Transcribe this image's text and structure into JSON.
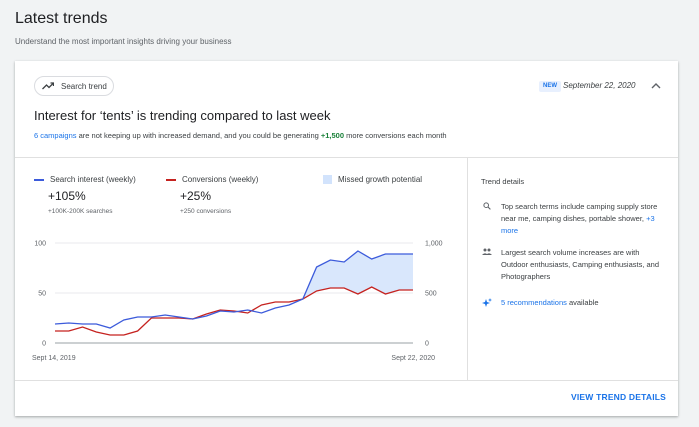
{
  "page": {
    "title": "Latest trends",
    "subtitle": "Understand the most important insights driving your business"
  },
  "card": {
    "chip_label": "Search trend",
    "new_badge": "NEW",
    "date": "September 22, 2020",
    "headline": "Interest for ‘tents’ is trending compared to last week",
    "desc": {
      "campaigns_link": "6 campaigns",
      "text1": " are not keeping up with increased demand, and you could be generating ",
      "conversions": "+1,500",
      "text2": " more conversions each month"
    }
  },
  "metrics": {
    "search": {
      "legend": "Search interest (weekly)",
      "value": "+105%",
      "sub": "+100K-200K searches",
      "color": "#3c5bdb"
    },
    "conversions": {
      "legend": "Conversions (weekly)",
      "value": "+25%",
      "sub": "+250 conversions",
      "color": "#c5221f"
    },
    "missed": {
      "legend": "Missed growth potential",
      "color": "#d2e3fc"
    }
  },
  "chart_data": {
    "type": "line",
    "x_start_label": "Sept 14, 2019",
    "x_end_label": "Sept 22, 2020",
    "y_left_ticks": [
      "100",
      "50",
      "0"
    ],
    "y_right_ticks": [
      "1,000",
      "500",
      "0"
    ],
    "ylim_left": [
      0,
      100
    ],
    "ylim_right": [
      0,
      1000
    ],
    "series": [
      {
        "name": "Search interest (weekly)",
        "axis": "left",
        "values": [
          19,
          20,
          19,
          19,
          15,
          23,
          26,
          26,
          28,
          26,
          24,
          27,
          32,
          31,
          33,
          30,
          35,
          38,
          44,
          76,
          83,
          81,
          92,
          84,
          89,
          89,
          89
        ]
      },
      {
        "name": "Conversions (weekly)",
        "axis": "right",
        "values": [
          120,
          120,
          160,
          110,
          80,
          80,
          120,
          250,
          250,
          250,
          240,
          290,
          330,
          320,
          300,
          380,
          410,
          410,
          440,
          520,
          550,
          550,
          490,
          560,
          490,
          530,
          530
        ]
      }
    ]
  },
  "details": {
    "title": "Trend details",
    "items": [
      {
        "text": "Top search terms include camping supply store near me, camping dishes, portable shower, ",
        "link": "+3 more"
      },
      {
        "text": "Largest search volume increases are with Outdoor enthusiasts, Camping enthusiasts, and Photographers"
      },
      {
        "link": "5 recommendations",
        "text": " available"
      }
    ]
  },
  "footer": {
    "view_button": "VIEW TREND DETAILS"
  }
}
